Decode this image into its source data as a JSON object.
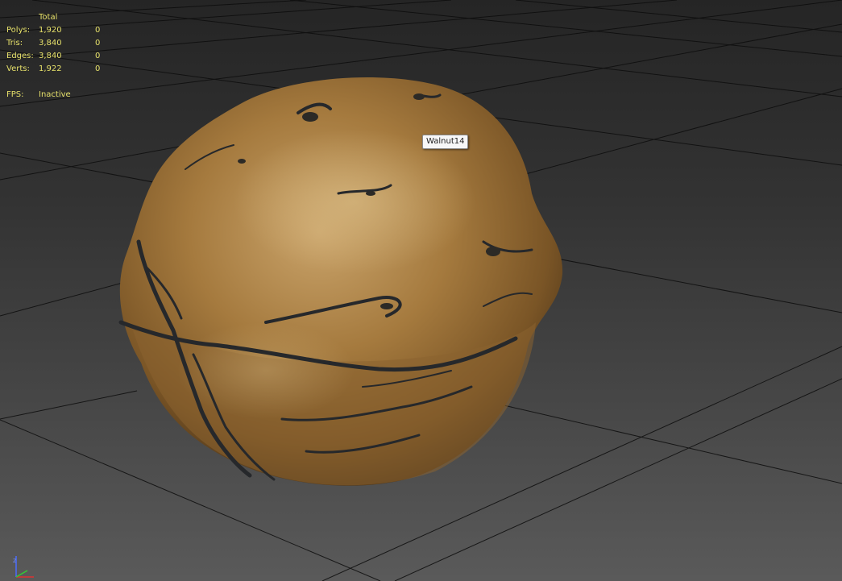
{
  "viewport": {
    "stats": {
      "header": "Total",
      "rows": [
        {
          "label": "Polys:",
          "total": "1,920",
          "selected": "0"
        },
        {
          "label": "Tris:",
          "total": "3,840",
          "selected": "0"
        },
        {
          "label": "Edges:",
          "total": "3,840",
          "selected": "0"
        },
        {
          "label": "Verts:",
          "total": "1,922",
          "selected": "0"
        }
      ],
      "fps_label": "FPS:",
      "fps_value": "Inactive"
    },
    "object_tooltip": "Walnut14",
    "axis_gizmo": {
      "vertical_axis": "z",
      "icon": "axis-tripod-icon"
    },
    "colors": {
      "stats_text": "#e6e06a",
      "grid_line": "#0d0d0d",
      "walnut_base": "#9a7238",
      "walnut_crease": "#26282b"
    }
  }
}
